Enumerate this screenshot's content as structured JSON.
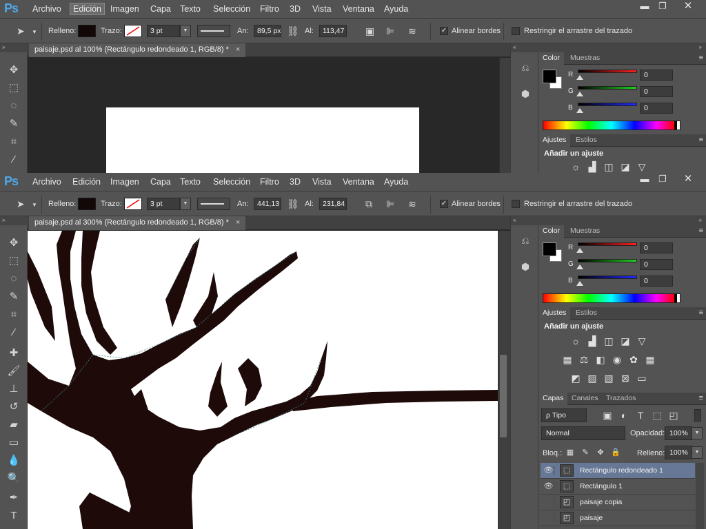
{
  "menus": [
    "Archivo",
    "Edición",
    "Imagen",
    "Capa",
    "Texto",
    "Selección",
    "Filtro",
    "3D",
    "Vista",
    "Ventana",
    "Ayuda"
  ],
  "app_logo": "Ps",
  "window_controls": {
    "minimize": "▬",
    "restore": "❐",
    "close": "✕"
  },
  "icons": {
    "arrow": "path-selection-arrow-icon",
    "link": "link-icon"
  },
  "colors": {
    "accent": "#4ea7e8",
    "fill_swatch": "#120808",
    "selection": "#677896",
    "red_slider": "#d42020",
    "green_slider": "#20c020",
    "blue_slider": "#1f2be0"
  },
  "windows": [
    {
      "active_menu": "Edición",
      "options": {
        "relleno_label": "Relleno:",
        "trazo_label": "Trazo:",
        "stroke_width": "3 pt",
        "an_label": "An:",
        "an_value": "89,5 px",
        "al_label": "Al:",
        "al_value": "113,47 ‖",
        "align_edges": "Alinear bordes",
        "align_edges_checked": true,
        "restrict_drag": "Restringir el arrastre del trazado",
        "restrict_drag_checked": false
      },
      "doc_tab": "paisaje.psd al 100% (Rectángulo redondeado 1, RGB/8) *",
      "doc_tab_close": "×",
      "panel_tabs": {
        "color": "Color",
        "muestras": "Muestras",
        "ajustes": "Ajustes",
        "estilos": "Estilos"
      },
      "rgb": [
        {
          "label": "R",
          "value": "0"
        },
        {
          "label": "G",
          "value": "0"
        },
        {
          "label": "B",
          "value": "0"
        }
      ],
      "adjust_title": "Añadir un ajuste"
    },
    {
      "active_menu": "",
      "options": {
        "relleno_label": "Relleno:",
        "trazo_label": "Trazo:",
        "stroke_width": "3 pt",
        "an_label": "An:",
        "an_value": "441,13 ‖",
        "al_label": "Al:",
        "al_value": "231,84 ‖",
        "align_edges": "Alinear bordes",
        "align_edges_checked": true,
        "restrict_drag": "Restringir el arrastre del trazado",
        "restrict_drag_checked": false
      },
      "doc_tab": "paisaje.psd al 300% (Rectángulo redondeado 1, RGB/8) *",
      "doc_tab_close": "×",
      "panel_tabs": {
        "color": "Color",
        "muestras": "Muestras",
        "ajustes": "Ajustes",
        "estilos": "Estilos"
      },
      "rgb": [
        {
          "label": "R",
          "value": "0"
        },
        {
          "label": "G",
          "value": "0"
        },
        {
          "label": "B",
          "value": "0"
        }
      ],
      "adjust_title": "Añadir un ajuste",
      "layers_panel": {
        "tabs": [
          "Capas",
          "Canales",
          "Trazados"
        ],
        "filter_kind": "ρ Tipo",
        "blend_mode": "Normal",
        "opacity_label": "Opacidad:",
        "opacity_value": "100%",
        "lock_label": "Bloq.:",
        "fill_label": "Relleno:",
        "fill_value": "100%",
        "layers": [
          {
            "name": "Rectángulo redondeado 1",
            "visible": true,
            "selected": true
          },
          {
            "name": "Rectángulo 1",
            "visible": true,
            "selected": false
          },
          {
            "name": "paisaje copia",
            "visible": false,
            "selected": false
          },
          {
            "name": "paisaje",
            "visible": false,
            "selected": false
          }
        ]
      }
    }
  ]
}
